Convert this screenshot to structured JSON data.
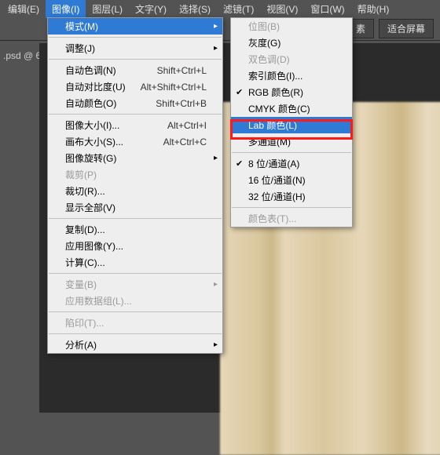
{
  "menubar": {
    "items": [
      "编辑(E)",
      "图像(I)",
      "图层(L)",
      "文字(Y)",
      "选择(S)",
      "滤镜(T)",
      "视图(V)",
      "窗口(W)",
      "帮助(H)"
    ],
    "active_index": 1
  },
  "toolbar": {
    "buttons": [
      "素",
      "适合屏幕"
    ]
  },
  "document": {
    "tab_label": ".psd @ 6"
  },
  "image_menu": {
    "items": [
      {
        "label": "模式(M)",
        "submenu": true,
        "highlight": true
      },
      null,
      {
        "label": "调整(J)",
        "submenu": true
      },
      null,
      {
        "label": "自动色调(N)",
        "shortcut": "Shift+Ctrl+L"
      },
      {
        "label": "自动对比度(U)",
        "shortcut": "Alt+Shift+Ctrl+L"
      },
      {
        "label": "自动颜色(O)",
        "shortcut": "Shift+Ctrl+B"
      },
      null,
      {
        "label": "图像大小(I)...",
        "shortcut": "Alt+Ctrl+I"
      },
      {
        "label": "画布大小(S)...",
        "shortcut": "Alt+Ctrl+C"
      },
      {
        "label": "图像旋转(G)",
        "submenu": true
      },
      {
        "label": "裁剪(P)",
        "disabled": true
      },
      {
        "label": "裁切(R)..."
      },
      {
        "label": "显示全部(V)"
      },
      null,
      {
        "label": "复制(D)..."
      },
      {
        "label": "应用图像(Y)..."
      },
      {
        "label": "计算(C)..."
      },
      null,
      {
        "label": "变量(B)",
        "submenu": true,
        "disabled": true
      },
      {
        "label": "应用数据组(L)...",
        "disabled": true
      },
      null,
      {
        "label": "陷印(T)...",
        "disabled": true
      },
      null,
      {
        "label": "分析(A)",
        "submenu": true
      }
    ]
  },
  "mode_submenu": {
    "items": [
      {
        "label": "位图(B)",
        "disabled": true
      },
      {
        "label": "灰度(G)"
      },
      {
        "label": "双色调(D)",
        "disabled": true
      },
      {
        "label": "索引颜色(I)..."
      },
      {
        "label": "RGB 颜色(R)",
        "checked": true
      },
      {
        "label": "CMYK 颜色(C)"
      },
      {
        "label": "Lab 颜色(L)",
        "highlight": true
      },
      {
        "label": "多通道(M)"
      },
      null,
      {
        "label": "8 位/通道(A)",
        "checked": true
      },
      {
        "label": "16 位/通道(N)"
      },
      {
        "label": "32 位/通道(H)"
      },
      null,
      {
        "label": "颜色表(T)...",
        "disabled": true
      }
    ]
  }
}
